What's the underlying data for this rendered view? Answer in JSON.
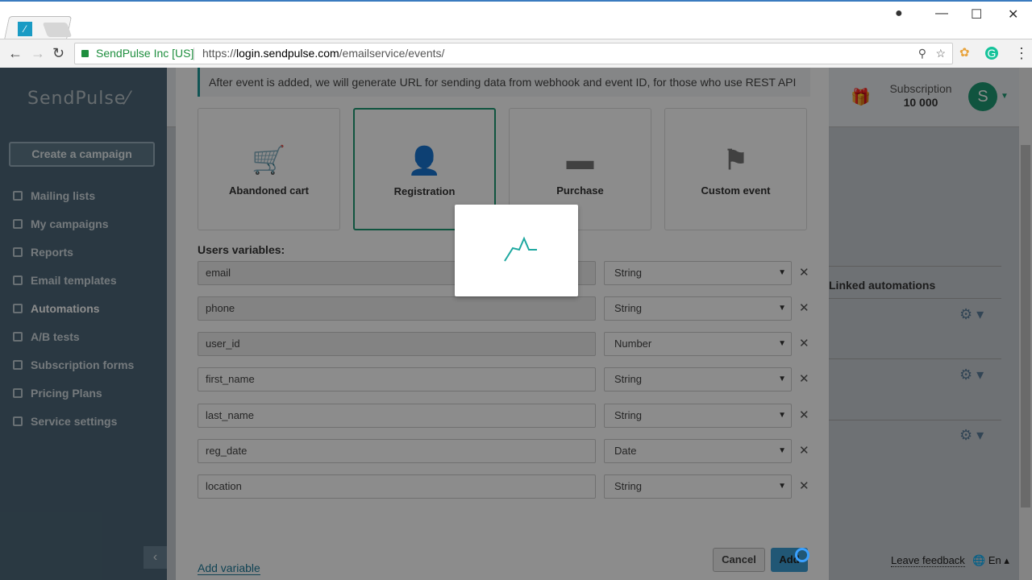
{
  "browser": {
    "secure_label": "SendPulse Inc [US]",
    "url_scheme": "https://",
    "url_host": "login.sendpulse.com",
    "url_path": "/emailservice/events/"
  },
  "sidebar": {
    "logo": "SendPulse",
    "create_button": "Create a campaign",
    "items": [
      {
        "label": "Mailing lists"
      },
      {
        "label": "My campaigns"
      },
      {
        "label": "Reports"
      },
      {
        "label": "Email templates"
      },
      {
        "label": "Automations",
        "active": true
      },
      {
        "label": "A/B tests"
      },
      {
        "label": "Subscription forms"
      },
      {
        "label": "Pricing Plans"
      },
      {
        "label": "Service settings"
      }
    ]
  },
  "header": {
    "subscription_label": "Subscription",
    "subscription_value": "10 000",
    "avatar_letter": "S"
  },
  "background": {
    "linked_automations": "Linked automations",
    "feedback": "Leave feedback",
    "language": "En"
  },
  "modal": {
    "info": "After event is added, we will generate URL for sending data from webhook and event ID, for those who use REST API",
    "event_types": [
      {
        "label": "Abandoned cart",
        "icon": "cart-icon"
      },
      {
        "label": "Registration",
        "icon": "user-icon",
        "selected": true
      },
      {
        "label": "Purchase",
        "icon": "credit-card-icon"
      },
      {
        "label": "Custom event",
        "icon": "flag-icon"
      }
    ],
    "variables_label": "Users variables:",
    "variables": [
      {
        "name": "email",
        "type": "String"
      },
      {
        "name": "phone",
        "type": "String"
      },
      {
        "name": "user_id",
        "type": "Number"
      },
      {
        "name": "first_name",
        "type": "String"
      },
      {
        "name": "last_name",
        "type": "String"
      },
      {
        "name": "reg_date",
        "type": "Date"
      },
      {
        "name": "location",
        "type": "String"
      }
    ],
    "add_variable": "Add variable",
    "cancel": "Cancel",
    "add": "Add"
  },
  "colors": {
    "accent": "#1e9a74",
    "link": "#1e7a9a",
    "primary_button": "#3c9fd6"
  }
}
